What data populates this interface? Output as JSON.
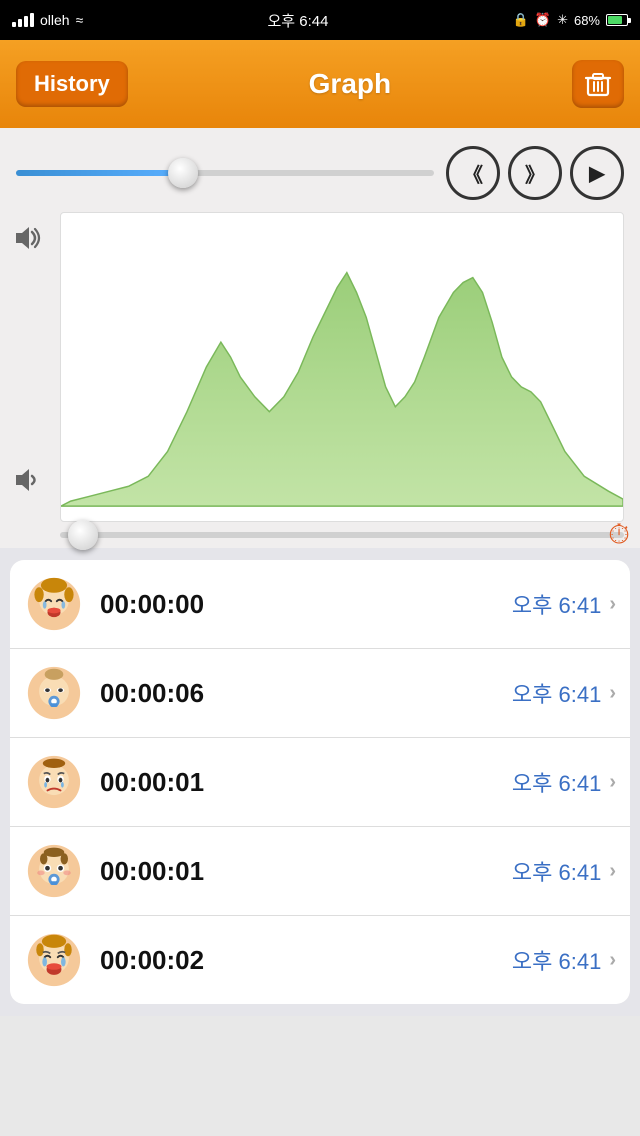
{
  "statusBar": {
    "carrier": "olleh",
    "time": "오후 6:44",
    "battery": "68%"
  },
  "navBar": {
    "historyLabel": "History",
    "title": "Graph",
    "trashIcon": "🗑"
  },
  "controls": {
    "rewindIcon": "《",
    "forwardIcon": "》",
    "playIcon": "▶"
  },
  "listItems": [
    {
      "id": 0,
      "time": "00:00:00",
      "date": "오후 6:41",
      "face": "crying"
    },
    {
      "id": 1,
      "time": "00:00:06",
      "date": "오후 6:41",
      "face": "sleepy"
    },
    {
      "id": 2,
      "time": "00:00:01",
      "date": "오후 6:41",
      "face": "sad"
    },
    {
      "id": 3,
      "time": "00:00:01",
      "date": "오후 6:41",
      "face": "happy"
    },
    {
      "id": 4,
      "time": "00:00:02",
      "date": "오후 6:41",
      "face": "crying2"
    }
  ]
}
